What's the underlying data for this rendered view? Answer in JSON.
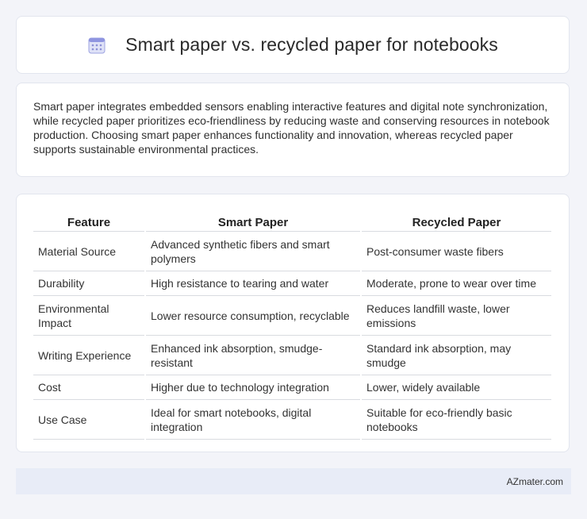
{
  "header": {
    "title": "Smart paper vs. recycled paper for notebooks",
    "icon": "calendar-icon"
  },
  "summary": {
    "text": "Smart paper integrates embedded sensors enabling interactive features and digital note synchronization, while recycled paper prioritizes eco-friendliness by reducing waste and conserving resources in notebook production. Choosing smart paper enhances functionality and innovation, whereas recycled paper supports sustainable environmental practices."
  },
  "table": {
    "headers": [
      "Feature",
      "Smart Paper",
      "Recycled Paper"
    ],
    "rows": [
      [
        "Material Source",
        "Advanced synthetic fibers and smart polymers",
        "Post-consumer waste fibers"
      ],
      [
        "Durability",
        "High resistance to tearing and water",
        "Moderate, prone to wear over time"
      ],
      [
        "Environmental Impact",
        "Lower resource consumption, recyclable",
        "Reduces landfill waste, lower emissions"
      ],
      [
        "Writing Experience",
        "Enhanced ink absorption, smudge-resistant",
        "Standard ink absorption, may smudge"
      ],
      [
        "Cost",
        "Higher due to technology integration",
        "Lower, widely available"
      ],
      [
        "Use Case",
        "Ideal for smart notebooks, digital integration",
        "Suitable for eco-friendly basic notebooks"
      ]
    ]
  },
  "footer": {
    "brand": "AZmater.com"
  },
  "colors": {
    "background": "#f3f4f9",
    "card": "#ffffff",
    "footer": "#e8ecf7",
    "icon_accent": "#7b7fd4"
  }
}
